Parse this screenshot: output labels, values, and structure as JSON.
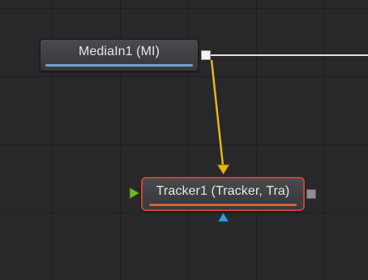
{
  "nodes": {
    "media": {
      "label": "MediaIn1  (MI)",
      "accent_color": "#6fa1d6"
    },
    "tracker": {
      "label": "Tracker1  (Tracker, Tra)",
      "accent_color": "#d3633c",
      "selected_border_color": "#c4453a"
    }
  },
  "connections": [
    {
      "from": "MediaIn1",
      "to": "Tracker1",
      "input": "background",
      "color": "#e8b41c"
    },
    {
      "from": "MediaIn1",
      "to": "offscreen",
      "color": "#e0e0e0"
    }
  ],
  "ports": {
    "background_input_color": "#6fb62c",
    "mask_input_color": "#2f9fe0"
  },
  "colors": {
    "canvas": "#28282a",
    "grid": "#1f1f21"
  }
}
